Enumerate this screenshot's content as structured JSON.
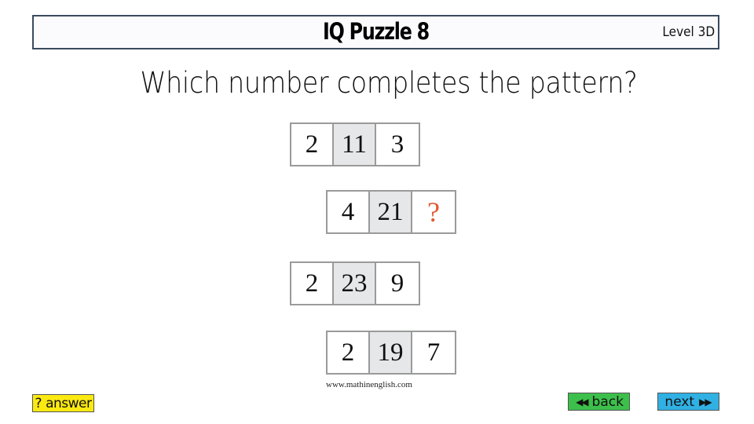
{
  "header": {
    "title": "IQ Puzzle 8",
    "level": "Level 3D"
  },
  "question": "Which number completes the pattern?",
  "puzzle": {
    "rows": [
      {
        "left": "2",
        "middle": "11",
        "right": "3"
      },
      {
        "left": "4",
        "middle": "21",
        "right": "?"
      },
      {
        "left": "2",
        "middle": "23",
        "right": "9"
      },
      {
        "left": "2",
        "middle": "19",
        "right": "7"
      }
    ],
    "unknown_color": "#e0582f",
    "middle_cell_color": "#e6e7e8"
  },
  "watermark": "www.mathinenglish.com",
  "buttons": {
    "answer": {
      "icon": "?",
      "label": "answer",
      "color": "#fbe911"
    },
    "back": {
      "icon": "◀◀",
      "label": "back",
      "color": "#3dbf4b"
    },
    "next": {
      "icon": "▶▶",
      "label": "next",
      "color": "#31b0e3"
    }
  }
}
